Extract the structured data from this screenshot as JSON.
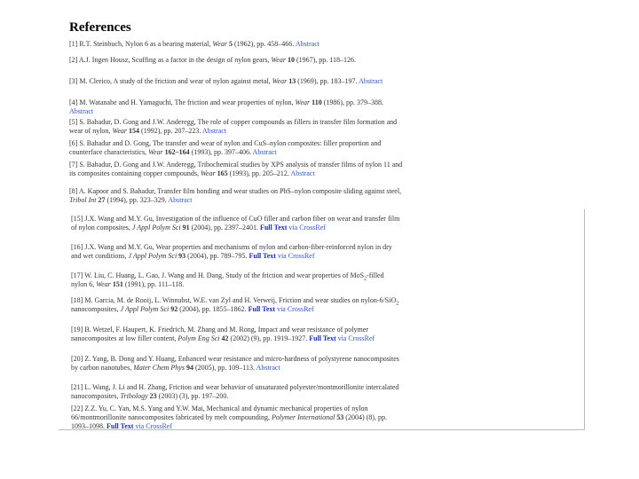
{
  "heading": "References",
  "refs_top": [
    {
      "pre": "[1] R.T. Steinbuch, Nylon 6 as a bearing material, ",
      "journal": "Wear",
      "sp1": " ",
      "vol": "5",
      "post": " (1962), pp. 458–466. ",
      "abstract": "Abstract"
    },
    {
      "pre": "[2] A.J. Ingen Housz, Scuffing as a factor in the design of nylon gears, ",
      "journal": "Wear",
      "sp1": " ",
      "vol": "10",
      "post": " (1967), pp. 118–126."
    },
    {
      "pre": "[3] M. Clerico, A study of the friction and wear of nylon against metal, ",
      "journal": "Wear",
      "sp1": " ",
      "vol": "13",
      "post": " (1969), pp. 183–197. ",
      "abstract": "Abstract"
    },
    {
      "pre": "[4] M. Watanabe and H. Yamaguchi, The friction and wear properties of nylon, ",
      "journal": "Wear",
      "sp1": " ",
      "vol": "110",
      "post": " (1986), pp. 379–388. ",
      "abstract": "Abstract"
    },
    {
      "pre": "[5] S. Bahadur, D. Gong and J.W. Anderegg, The role of copper compounds as fillers in transfer film formation and wear of nylon, ",
      "journal": "Wear",
      "sp1": " ",
      "vol": "154",
      "post": " (1992), pp. 207–223. ",
      "abstract": "Abstract"
    },
    {
      "pre": "[6] S. Bahadur and D. Gong, The transfer and wear of nylon and CuS–nylon composites: filler proportion and counterface characteristics, ",
      "journal": "Wear",
      "sp1": " ",
      "vol": "162–164",
      "post": " (1993), pp. 397–406. ",
      "abstract": "Abstract"
    },
    {
      "pre": "[7] S. Bahadur, D. Gong and J.W. Anderegg, Tribochemical studies by XPS analysis of transfer films of nylon 11 and its composites containing copper compounds, ",
      "journal": "Wear",
      "sp1": " ",
      "vol": "165",
      "post": " (1993), pp. 205–212. ",
      "abstract": "Abstract"
    },
    {
      "pre": "[8] A. Kapoor and S. Bahadur, Transfer film bonding and wear studies on PbS–nylon composite sliding against steel, ",
      "journal": "Tribol Int",
      "sp1": " ",
      "vol": "27",
      "post": " (1994), pp. 323–329. ",
      "abstract": "Abstract"
    }
  ],
  "refs_bottom": [
    {
      "pre": "[15] J.X. Wang and M.Y. Gu, Investigation of the influence of CuO filler and carbon fiber on wear and transfer film of nylon composites, ",
      "journal": "J Appl Polym Sci",
      "sp1": " ",
      "vol": "91",
      "post": " (2004), pp. 2397–2401. ",
      "fulltext": "Full Text",
      "via": " via ",
      "crossref": "CrossRef"
    },
    {
      "pre": "[16] J.X. Wang and M.Y. Gu, Wear properties and mechanisms of nylon and carbon-fiber-reinforced nylon in dry and wet conditions, ",
      "journal": "J Appl Polym Sci",
      "sp1": " ",
      "vol": "93",
      "post": " (2004), pp. 789–795. ",
      "fulltext": "Full Text",
      "via": " via ",
      "crossref": "CrossRef"
    },
    {
      "pre": "[17] W. Liu, C. Huang, L. Gao, J. Wang and H. Dang, Study of the friction and wear properties of MoS",
      "sub": "2",
      "pre2": "-filled nylon 6, ",
      "journal": "Wear",
      "sp1": " ",
      "vol": "151",
      "post": " (1991), pp. 111–118."
    },
    {
      "pre": "[18] M. Garcia, M. de Rooij, L. Winnubst, W.E. van Zyl and H. Verweij, Friction and wear studies on nylon-6/SiO",
      "sub": "2",
      "pre2": " nanocomposites, ",
      "journal": "J Appl Polym Sci",
      "sp1": " ",
      "vol": "92",
      "post": " (2004), pp. 1855–1862. ",
      "fulltext": "Full Text",
      "via": " via ",
      "crossref": "CrossRef"
    },
    {
      "pre": "[19] B. Wetzel, F. Haupert, K. Friedrich, M. Zhang and M. Rong, Impact and wear resistance of polymer nanocomposites at low filler content, ",
      "journal": "Polym Eng Sci",
      "sp1": " ",
      "vol": "42",
      "post": " (2002) (9), pp. 1919–1927. ",
      "fulltext": "Full Text",
      "via": " via ",
      "crossref": "CrossRef"
    },
    {
      "pre": "[20] Z. Yang, B. Dong and Y. Huang, Enhanced wear resistance and micro-hardness of polystyrene nanocomposites by carbon nanotubes, ",
      "journal": "Mater Chem Phys",
      "sp1": " ",
      "vol": "94",
      "post": " (2005), pp. 109–113. ",
      "abstract": "Abstract"
    },
    {
      "pre": "[21] L. Wang, J. Li and H. Zhang, Friction and wear behavior of unsaturated polyester/montmorillonite intercalated nanocomposites, ",
      "journal": "Tribology",
      "sp1": " ",
      "vol": "23",
      "post": " (2003) (3), pp. 197–200."
    },
    {
      "pre": "[22] Z.Z. Yu, C. Yan, M.S. Yang and Y.W. Mai, Mechanical and dynamic mechanical properties of nylon 66/montmorillonite nanocomposites fabricated by melt compounding, ",
      "journal": "Polymer International",
      "sp1": " ",
      "vol": "53",
      "post": " (2004) (8), pp. 1093–1098. ",
      "fulltext": "Full Text",
      "via": " via ",
      "crossref": "CrossRef"
    }
  ]
}
